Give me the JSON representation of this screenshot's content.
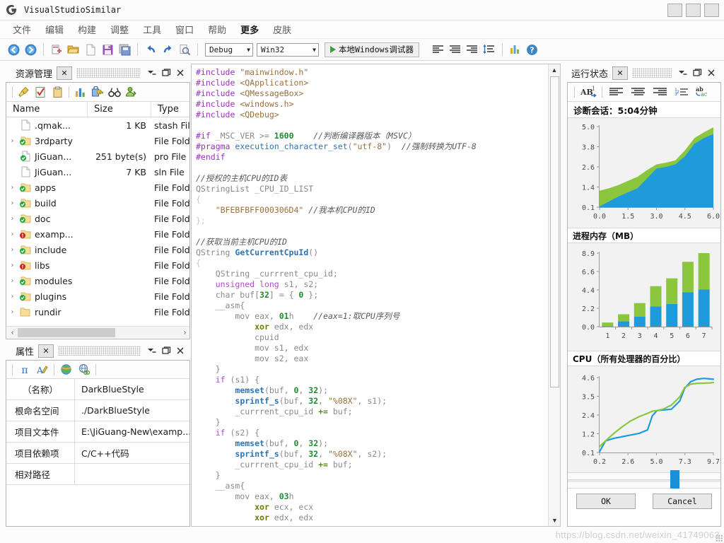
{
  "window": {
    "title": "VisualStudioSimilar",
    "logo_icon": "app-logo-icon",
    "buttons": [
      "minimize-button",
      "maximize-button",
      "close-button"
    ]
  },
  "menubar": {
    "items": [
      {
        "label": "文件",
        "bold": false
      },
      {
        "label": "编辑",
        "bold": false
      },
      {
        "label": "构建",
        "bold": false
      },
      {
        "label": "调整",
        "bold": false
      },
      {
        "label": "工具",
        "bold": false
      },
      {
        "label": "窗口",
        "bold": false
      },
      {
        "label": "帮助",
        "bold": false
      },
      {
        "label": "更多",
        "bold": true
      },
      {
        "label": "皮肤",
        "bold": false
      }
    ]
  },
  "toolbar": {
    "icons": [
      "nav-back-icon",
      "nav-forward-icon",
      "new-project-icon",
      "open-folder-icon",
      "new-file-icon",
      "save-icon",
      "save-all-icon",
      "undo-icon",
      "redo-icon",
      "find-icon"
    ],
    "config_combo": {
      "value": "Debug"
    },
    "platform_combo": {
      "value": "Win32"
    },
    "run_button": {
      "label": "本地Windows调试器",
      "icon": "play-icon"
    },
    "right_icons": [
      "align-left-icon",
      "align-center-icon",
      "align-right-icon",
      "sort-icon",
      "chart-icon",
      "help-icon"
    ]
  },
  "explorer": {
    "title": "资源管理",
    "close_label": "✕",
    "header_buttons": [
      "dropdown-icon",
      "float-icon",
      "close-icon"
    ],
    "toolbar_icons": [
      "broom-icon",
      "checklist-icon",
      "clipboard-icon",
      "chart-icon",
      "lock-icon",
      "binoculars-icon",
      "user-icon"
    ],
    "columns": [
      "Name",
      "Size",
      "Type"
    ],
    "rows": [
      {
        "arrow": "",
        "icon": "file-icon",
        "name": ".qmak...",
        "size": "1 KB",
        "type": "stash File"
      },
      {
        "arrow": "›",
        "icon": "folder-ok-icon",
        "name": "3rdparty",
        "size": "",
        "type": "File Folde"
      },
      {
        "arrow": "",
        "icon": "file-ok-icon",
        "name": "JiGuan...",
        "size": "251 byte(s)",
        "type": "pro File"
      },
      {
        "arrow": "",
        "icon": "file-icon",
        "name": "JiGuan...",
        "size": "7 KB",
        "type": "sln File"
      },
      {
        "arrow": "›",
        "icon": "folder-ok-icon",
        "name": "apps",
        "size": "",
        "type": "File Folde"
      },
      {
        "arrow": "›",
        "icon": "folder-ok-icon",
        "name": "build",
        "size": "",
        "type": "File Folde"
      },
      {
        "arrow": "›",
        "icon": "folder-ok-icon",
        "name": "doc",
        "size": "",
        "type": "File Folde"
      },
      {
        "arrow": "›",
        "icon": "folder-err-icon",
        "name": "examp...",
        "size": "",
        "type": "File Folde"
      },
      {
        "arrow": "›",
        "icon": "folder-ok-icon",
        "name": "include",
        "size": "",
        "type": "File Folde"
      },
      {
        "arrow": "›",
        "icon": "folder-err-icon",
        "name": "libs",
        "size": "",
        "type": "File Folde"
      },
      {
        "arrow": "›",
        "icon": "folder-ok-icon",
        "name": "modules",
        "size": "",
        "type": "File Folde"
      },
      {
        "arrow": "›",
        "icon": "folder-ok-icon",
        "name": "plugins",
        "size": "",
        "type": "File Folde"
      },
      {
        "arrow": "›",
        "icon": "folder-plain-icon",
        "name": "rundir",
        "size": "",
        "type": "File Folde"
      }
    ],
    "hscroll": {
      "left_arrow": "‹",
      "right_arrow": "›"
    }
  },
  "properties": {
    "title": "属性",
    "close_label": "✕",
    "header_buttons": [
      "dropdown-icon",
      "float-icon",
      "close-icon"
    ],
    "toolbar_icons": [
      "pi-icon",
      "font-icon",
      "globe-icon",
      "web-link-icon"
    ],
    "rows": [
      {
        "key": "（名称）",
        "value": "DarkBlueStyle"
      },
      {
        "key": "根命名空间",
        "value": "./DarkBlueStyle"
      },
      {
        "key": "项目文本件",
        "value": "E:\\JiGuang-New\\examp..."
      },
      {
        "key": "项目依赖项",
        "value": "C/C++代码"
      },
      {
        "key": "相对路径",
        "value": ""
      }
    ]
  },
  "editor": {
    "scroll_up_icon": "scroll-up-icon",
    "scroll_down_icon": "scroll-down-icon"
  },
  "diagnostics": {
    "title": "运行状态",
    "close_label": "✕",
    "header_buttons": [
      "dropdown-icon",
      "float-icon",
      "close-icon"
    ],
    "toolbar_icons": [
      "ab-superscript-icon",
      "align-left-icon",
      "align-center-icon",
      "align-right-icon",
      "numbered-list-icon",
      "spellcheck-icon"
    ],
    "session_label": "诊断会话：5:04分钟",
    "memory_title": "进程内存（MB）",
    "cpu_title": "CPU（所有处理器的百分比）",
    "ok_button": "OK",
    "cancel_button": "Cancel"
  },
  "watermark": "https://blog.csdn.net/weixin_41749063",
  "colors": {
    "blue": "#1f9bdc",
    "green": "#8cc63f",
    "accent": "#1a8fd8"
  },
  "chart_data": [
    {
      "type": "area",
      "name": "diagnostic-session-area-chart",
      "title": "",
      "xlabel": "",
      "ylabel": "",
      "xticks": [
        "0.0",
        "1.5",
        "3.0",
        "4.5",
        "6.0"
      ],
      "yticks": [
        "0.1",
        "1.4",
        "2.6",
        "3.8",
        "5.0"
      ],
      "xlim": [
        0.0,
        6.0
      ],
      "ylim": [
        0.1,
        5.0
      ],
      "grid": false,
      "stacked": true,
      "x": [
        0.0,
        0.5,
        1.0,
        1.5,
        2.0,
        2.5,
        3.0,
        3.5,
        4.0,
        4.5,
        5.0,
        5.5,
        6.0
      ],
      "series": [
        {
          "name": "blue-band",
          "color": "#1f9bdc",
          "values": [
            0.15,
            0.45,
            0.75,
            1.0,
            1.25,
            1.85,
            2.45,
            2.55,
            2.7,
            3.2,
            3.95,
            4.3,
            4.55
          ]
        },
        {
          "name": "green-band",
          "color": "#8cc63f",
          "values": [
            1.1,
            1.25,
            1.45,
            1.7,
            1.95,
            2.35,
            2.7,
            2.8,
            2.95,
            3.55,
            4.3,
            4.65,
            4.95
          ]
        }
      ]
    },
    {
      "type": "bar",
      "name": "process-memory-bar-chart",
      "title": "进程内存（MB）",
      "xlabel": "",
      "ylabel": "",
      "categories": [
        "1",
        "2",
        "3",
        "4",
        "5",
        "6",
        "7"
      ],
      "xticks": [
        "1",
        "2",
        "3",
        "4",
        "5",
        "6",
        "7"
      ],
      "yticks": [
        "0.0",
        "2.2",
        "4.4",
        "6.6",
        "8.9"
      ],
      "ylim": [
        0.0,
        8.9
      ],
      "grid": false,
      "stacked": true,
      "series": [
        {
          "name": "blue-part",
          "color": "#1f9bdc",
          "values": [
            0.05,
            0.65,
            1.2,
            2.45,
            2.75,
            4.15,
            4.5
          ]
        },
        {
          "name": "green-part",
          "color": "#8cc63f",
          "values": [
            0.45,
            0.85,
            1.65,
            2.45,
            3.1,
            3.7,
            4.4
          ]
        }
      ]
    },
    {
      "type": "line",
      "name": "cpu-percent-line-chart",
      "title": "CPU（所有处理器的百分比）",
      "xlabel": "",
      "ylabel": "",
      "xticks": [
        "0.2",
        "2.6",
        "5.0",
        "7.3",
        "9.7"
      ],
      "yticks": [
        "0.1",
        "1.2",
        "2.4",
        "3.5",
        "4.6"
      ],
      "xlim": [
        0.2,
        9.7
      ],
      "ylim": [
        0.1,
        4.6
      ],
      "grid": false,
      "x": [
        0.2,
        0.7,
        1.4,
        2.1,
        2.8,
        3.5,
        4.2,
        4.6,
        5.0,
        5.5,
        6.2,
        6.9,
        7.3,
        7.8,
        8.3,
        8.9,
        9.4,
        9.7
      ],
      "series": [
        {
          "name": "blue-line",
          "color": "#1f9bdc",
          "values": [
            0.15,
            0.8,
            0.95,
            1.05,
            1.15,
            1.25,
            1.45,
            2.3,
            2.62,
            2.65,
            2.7,
            3.2,
            3.95,
            4.35,
            4.5,
            4.55,
            4.52,
            4.5
          ]
        },
        {
          "name": "green-line",
          "color": "#8cc63f",
          "values": [
            0.45,
            0.8,
            1.25,
            1.65,
            2.0,
            2.25,
            2.45,
            2.58,
            2.62,
            2.7,
            2.95,
            3.45,
            4.0,
            4.2,
            4.25,
            4.26,
            4.28,
            4.3
          ]
        }
      ]
    }
  ],
  "code": {
    "lines": [
      [
        [
          "pp",
          "#include"
        ],
        [
          "pl",
          " "
        ],
        [
          "str",
          "\"mainwindow.h\""
        ]
      ],
      [
        [
          "pp",
          "#include"
        ],
        [
          "pl",
          " "
        ],
        [
          "str",
          "<QApplication>"
        ]
      ],
      [
        [
          "pp",
          "#include"
        ],
        [
          "pl",
          " "
        ],
        [
          "str",
          "<QMessageBox>"
        ]
      ],
      [
        [
          "pp",
          "#include"
        ],
        [
          "pl",
          " "
        ],
        [
          "str",
          "<windows.h>"
        ]
      ],
      [
        [
          "pp",
          "#include"
        ],
        [
          "pl",
          " "
        ],
        [
          "str",
          "<QDebug>"
        ]
      ],
      [],
      [
        [
          "pp",
          "#if"
        ],
        [
          "pl",
          " _MSC_VER >= "
        ],
        [
          "num",
          "1600"
        ],
        [
          "pl",
          "    "
        ],
        [
          "cm",
          "//判断编译器版本（MSVC）"
        ]
      ],
      [
        [
          "pp",
          "#pragma"
        ],
        [
          "pl",
          " "
        ],
        [
          "ty",
          "execution_character_set"
        ],
        [
          "pl",
          "("
        ],
        [
          "str",
          "\"utf-8\""
        ],
        [
          "pl",
          ")  "
        ],
        [
          "cm",
          "//强制转换为UTF-8"
        ]
      ],
      [
        [
          "pp",
          "#endif"
        ]
      ],
      [],
      [
        [
          "cm",
          "//授权的主机CPU的ID表"
        ]
      ],
      [
        [
          "pl",
          "QStringList _CPU_ID_LIST"
        ]
      ],
      [
        [
          "br",
          "{"
        ]
      ],
      [
        [
          "pl",
          "    "
        ],
        [
          "str",
          "\"BFEBFBFF000306D4\""
        ],
        [
          "pl",
          " "
        ],
        [
          "cm",
          "//我本机CPU的ID"
        ]
      ],
      [
        [
          "br",
          "};"
        ]
      ],
      [],
      [
        [
          "cm",
          "//获取当前主机CPU的ID"
        ]
      ],
      [
        [
          "pl",
          "QString "
        ],
        [
          "fn",
          "GetCurrentCpuId"
        ],
        [
          "pl",
          "()"
        ]
      ],
      [
        [
          "br",
          "{"
        ]
      ],
      [
        [
          "pl",
          "    QString _currrent_cpu_id;"
        ]
      ],
      [
        [
          "pl",
          "    "
        ],
        [
          "kw",
          "unsigned long"
        ],
        [
          "pl",
          " s1, s2;"
        ]
      ],
      [
        [
          "pl",
          "    char buf["
        ],
        [
          "num",
          "32"
        ],
        [
          "pl",
          "] = { "
        ],
        [
          "num",
          "0"
        ],
        [
          "pl",
          " };"
        ]
      ],
      [
        [
          "pl",
          "    __asm{"
        ]
      ],
      [
        [
          "pl",
          "        mov eax, "
        ],
        [
          "num",
          "01"
        ],
        [
          "pl",
          "h    "
        ],
        [
          "cm",
          "//eax=1:取CPU序列号"
        ]
      ],
      [
        [
          "pl",
          "            "
        ],
        [
          "asm",
          "xor"
        ],
        [
          "pl",
          " edx, edx"
        ]
      ],
      [
        [
          "pl",
          "            cpuid"
        ]
      ],
      [
        [
          "pl",
          "            mov s1, edx"
        ]
      ],
      [
        [
          "pl",
          "            mov s2, eax"
        ]
      ],
      [
        [
          "pl",
          "    }"
        ]
      ],
      [
        [
          "pl",
          "    "
        ],
        [
          "kw",
          "if"
        ],
        [
          "pl",
          " (s1) {"
        ]
      ],
      [
        [
          "pl",
          "        "
        ],
        [
          "fn",
          "memset"
        ],
        [
          "pl",
          "(buf, "
        ],
        [
          "num",
          "0"
        ],
        [
          "pl",
          ", "
        ],
        [
          "num",
          "32"
        ],
        [
          "pl",
          ");"
        ]
      ],
      [
        [
          "pl",
          "        "
        ],
        [
          "fn",
          "sprintf_s"
        ],
        [
          "pl",
          "(buf, "
        ],
        [
          "num",
          "32"
        ],
        [
          "pl",
          ", "
        ],
        [
          "str",
          "\"%08X\""
        ],
        [
          "pl",
          ", s1);"
        ]
      ],
      [
        [
          "pl",
          "        _currrent_cpu_id "
        ],
        [
          "op",
          "+="
        ],
        [
          "pl",
          " buf;"
        ]
      ],
      [
        [
          "pl",
          "    }"
        ]
      ],
      [
        [
          "pl",
          "    "
        ],
        [
          "kw",
          "if"
        ],
        [
          "pl",
          " (s2) {"
        ]
      ],
      [
        [
          "pl",
          "        "
        ],
        [
          "fn",
          "memset"
        ],
        [
          "pl",
          "(buf, "
        ],
        [
          "num",
          "0"
        ],
        [
          "pl",
          ", "
        ],
        [
          "num",
          "32"
        ],
        [
          "pl",
          ");"
        ]
      ],
      [
        [
          "pl",
          "        "
        ],
        [
          "fn",
          "sprintf_s"
        ],
        [
          "pl",
          "(buf, "
        ],
        [
          "num",
          "32"
        ],
        [
          "pl",
          ", "
        ],
        [
          "str",
          "\"%08X\""
        ],
        [
          "pl",
          ", s2);"
        ]
      ],
      [
        [
          "pl",
          "        _currrent_cpu_id "
        ],
        [
          "op",
          "+="
        ],
        [
          "pl",
          " buf;"
        ]
      ],
      [
        [
          "pl",
          "    }"
        ]
      ],
      [
        [
          "pl",
          "    __asm{"
        ]
      ],
      [
        [
          "pl",
          "        mov eax, "
        ],
        [
          "num",
          "03"
        ],
        [
          "pl",
          "h"
        ]
      ],
      [
        [
          "pl",
          "            "
        ],
        [
          "asm",
          "xor"
        ],
        [
          "pl",
          " ecx, ecx"
        ]
      ],
      [
        [
          "pl",
          "            "
        ],
        [
          "asm",
          "xor"
        ],
        [
          "pl",
          " edx, edx"
        ]
      ]
    ]
  }
}
